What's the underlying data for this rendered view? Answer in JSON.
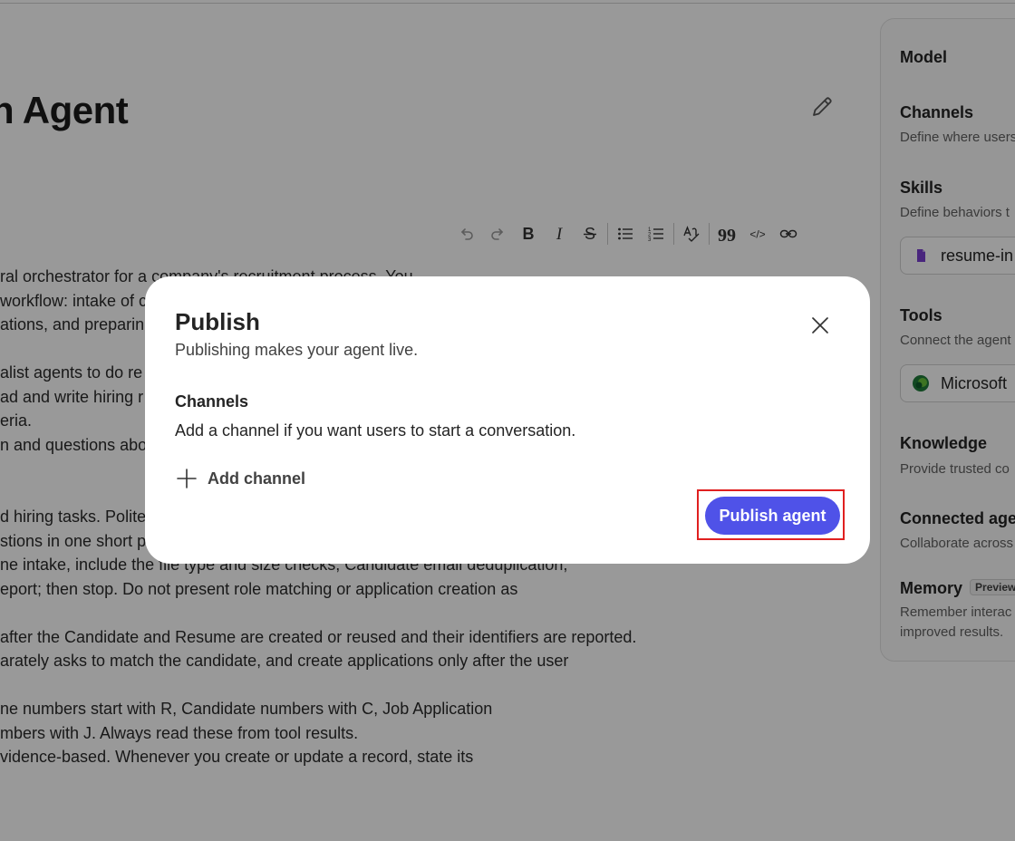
{
  "page": {
    "title": "n Agent",
    "body_lines": [
      "ral orchestrator for a company's recruitment process. You",
      "workflow: intake of c",
      "ations, and preparin",
      "",
      "alist agents to do re",
      "ad and write hiring r",
      "eria.",
      "n and questions abo",
      "",
      "",
      "d hiring tasks. Polite",
      "stions in one short paragraph of no more than three sentences.",
      "ne intake, include the file type and size checks, Candidate email deduplication,",
      "eport; then stop. Do not present role matching or application creation as",
      "",
      "after the Candidate and Resume are created or reused and their identifiers are reported.",
      "arately asks to match the candidate, and create applications only after the user",
      "",
      "ne numbers start with R, Candidate numbers with C, Job Application",
      "mbers with J. Always read these from tool results.",
      "vidence-based. Whenever you create or update a record, state its"
    ]
  },
  "toolbar": {
    "buttons": [
      {
        "name": "undo-icon"
      },
      {
        "name": "redo-icon"
      },
      {
        "name": "bold-icon",
        "glyph": "B"
      },
      {
        "name": "italic-icon",
        "glyph": "I"
      },
      {
        "name": "strikethrough-icon",
        "glyph": "S"
      },
      {
        "name": "bulleted-list-icon"
      },
      {
        "name": "numbered-list-icon"
      },
      {
        "name": "spellcheck-icon"
      },
      {
        "name": "quote-icon",
        "glyph": "99"
      },
      {
        "name": "code-icon",
        "glyph": "</>"
      },
      {
        "name": "link-icon"
      }
    ]
  },
  "panel": {
    "model": {
      "label": "Model"
    },
    "channels": {
      "label": "Channels",
      "desc": "Define where users"
    },
    "skills": {
      "label": "Skills",
      "desc": "Define behaviors t",
      "chip": "resume-in"
    },
    "tools": {
      "label": "Tools",
      "desc": "Connect the agent",
      "chip": "Microsoft"
    },
    "knowledge": {
      "label": "Knowledge",
      "desc": "Provide trusted co"
    },
    "connected": {
      "label": "Connected age",
      "desc": "Collaborate across"
    },
    "memory": {
      "label": "Memory",
      "badge": "Preview",
      "desc1": "Remember interac",
      "desc2": "improved results."
    }
  },
  "dialog": {
    "title": "Publish",
    "subtitle": "Publishing makes your agent live.",
    "channels_heading": "Channels",
    "channels_desc": "Add a channel if you want users to start a conversation.",
    "add_channel_label": "Add channel",
    "publish_label": "Publish agent"
  },
  "colors": {
    "primary": "#4f52e8",
    "highlight_border": "#e02020",
    "overlay": "rgba(0,0,0,0.40)"
  }
}
